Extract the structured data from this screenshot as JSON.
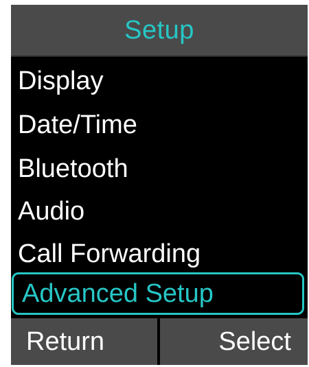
{
  "header": {
    "title": "Setup"
  },
  "menu": {
    "items": [
      {
        "label": "Display"
      },
      {
        "label": "Date/Time"
      },
      {
        "label": "Bluetooth"
      },
      {
        "label": "Audio"
      },
      {
        "label": "Call Forwarding"
      },
      {
        "label": "Advanced Setup",
        "selected": true
      }
    ]
  },
  "softkeys": {
    "left_label": "Return",
    "right_label": "Select"
  },
  "colors": {
    "accent": "#27c6c6",
    "bar_background": "#4a4a4a",
    "screen_background": "#000000",
    "text": "#ffffff"
  }
}
